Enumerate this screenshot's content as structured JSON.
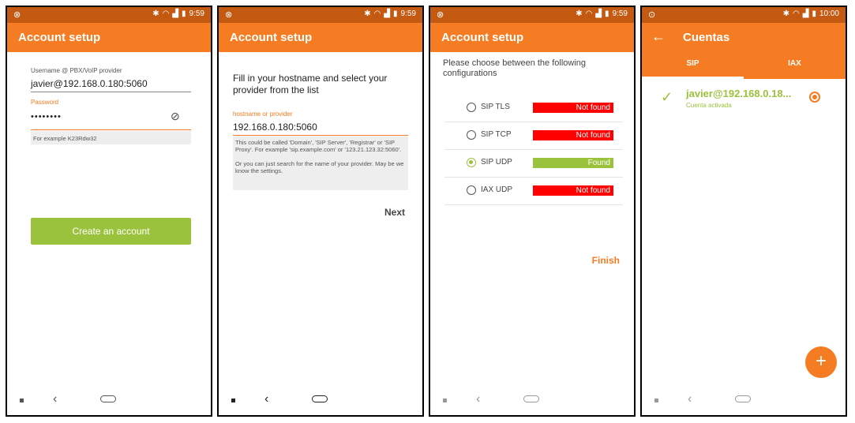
{
  "status_bar": {
    "screen1": {
      "time": "9:59"
    },
    "screen2": {
      "time": "9:59"
    },
    "screen3": {
      "time": "9:59"
    },
    "screen4": {
      "time": "10:00"
    }
  },
  "screen1": {
    "title": "Account setup",
    "username_label": "Username @ PBX/VoIP provider",
    "username_value": "javier@192.168.0.180:5060",
    "password_label": "Password",
    "password_value": "••••••••",
    "password_hint": "For example K23Rdw32",
    "create_button": "Create an account"
  },
  "screen2": {
    "title": "Account setup",
    "instruction": "Fill in your hostname and select your provider from the list",
    "host_label": "hostname or provider",
    "host_value": "192.168.0.180:5060",
    "hint1": "This could be called 'Domain', 'SIP Server', 'Registrar' or 'SIP Proxy'. For example 'sip.example.com' or '123.21.123.32:5060'.",
    "hint2": "Or you can just search for the name of your provider. May be we know the settings.",
    "next_button": "Next"
  },
  "screen3": {
    "title": "Account setup",
    "instruction": "Please choose between the following configurations",
    "configs": [
      {
        "name": "SIP TLS",
        "status": "Not found",
        "color": "#ff0000",
        "selected": false
      },
      {
        "name": "SIP TCP",
        "status": "Not found",
        "color": "#ff0000",
        "selected": false
      },
      {
        "name": "SIP UDP",
        "status": "Found",
        "color": "#9bc23c",
        "selected": true
      },
      {
        "name": "IAX UDP",
        "status": "Not found",
        "color": "#ff0000",
        "selected": false
      }
    ],
    "finish_button": "Finish"
  },
  "screen4": {
    "title": "Cuentas",
    "tabs": [
      "SIP",
      "IAX"
    ],
    "account_name": "javier@192.168.0.18...",
    "account_status": "Cuenta activada"
  },
  "colors": {
    "primary": "#f57c22",
    "status_bar": "#c45a12",
    "success": "#9bc23c",
    "error": "#ff0000"
  }
}
